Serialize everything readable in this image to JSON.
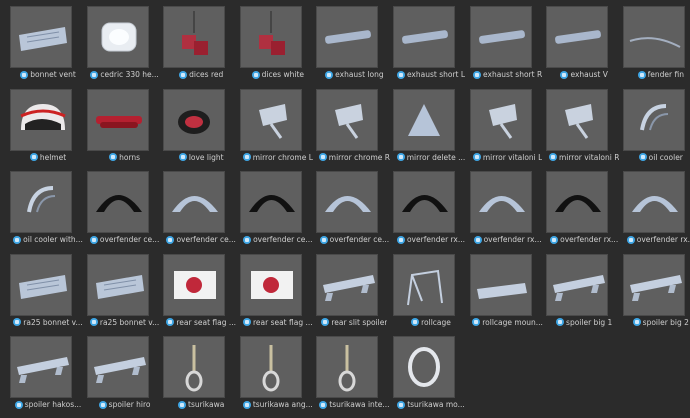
{
  "assets": [
    {
      "label": "bonnet vent",
      "icon": "bonnet-vent-thumbnail"
    },
    {
      "label": "cedric 330 he...",
      "icon": "headlight-thumbnail"
    },
    {
      "label": "dices red",
      "icon": "dice-thumbnail"
    },
    {
      "label": "dices white",
      "icon": "dice-thumbnail"
    },
    {
      "label": "exhaust long",
      "icon": "exhaust-thumbnail"
    },
    {
      "label": "exhaust short L",
      "icon": "exhaust-thumbnail"
    },
    {
      "label": "exhaust short R",
      "icon": "exhaust-thumbnail"
    },
    {
      "label": "exhaust V",
      "icon": "exhaust-thumbnail"
    },
    {
      "label": "fender fin",
      "icon": "fin-thumbnail"
    },
    {
      "label": "helmet",
      "icon": "helmet-thumbnail"
    },
    {
      "label": "horns",
      "icon": "horns-thumbnail"
    },
    {
      "label": "love light",
      "icon": "light-thumbnail"
    },
    {
      "label": "mirror chrome L",
      "icon": "mirror-thumbnail"
    },
    {
      "label": "mirror chrome R",
      "icon": "mirror-thumbnail"
    },
    {
      "label": "mirror delete ...",
      "icon": "mirror-delete-thumbnail"
    },
    {
      "label": "mirror vitaloni L",
      "icon": "mirror-thumbnail"
    },
    {
      "label": "mirror vitaloni R",
      "icon": "mirror-thumbnail"
    },
    {
      "label": "oil cooler",
      "icon": "oil-cooler-thumbnail"
    },
    {
      "label": "oil cooler with...",
      "icon": "oil-cooler-thumbnail"
    },
    {
      "label": "overfender ce...",
      "icon": "overfender-black-thumbnail"
    },
    {
      "label": "overfender ce...",
      "icon": "overfender-thumbnail"
    },
    {
      "label": "overfender ce...",
      "icon": "overfender-black-thumbnail"
    },
    {
      "label": "overfender ce...",
      "icon": "overfender-thumbnail"
    },
    {
      "label": "overfender rx...",
      "icon": "overfender-black-thumbnail"
    },
    {
      "label": "overfender rx...",
      "icon": "overfender-thumbnail"
    },
    {
      "label": "overfender rx...",
      "icon": "overfender-black-thumbnail"
    },
    {
      "label": "overfender rx...",
      "icon": "overfender-thumbnail"
    },
    {
      "label": "ra25 bonnet v...",
      "icon": "bonnet-vent-thumbnail"
    },
    {
      "label": "ra25 bonnet v...",
      "icon": "bonnet-vent-thumbnail"
    },
    {
      "label": "rear seat flag ...",
      "icon": "flag-thumbnail"
    },
    {
      "label": "rear seat flag ...",
      "icon": "flag-thumbnail"
    },
    {
      "label": "rear slit spoiler",
      "icon": "spoiler-thumbnail"
    },
    {
      "label": "rollcage",
      "icon": "rollcage-thumbnail"
    },
    {
      "label": "rollcage moun...",
      "icon": "rollcage-mount-thumbnail"
    },
    {
      "label": "spoiler big 1",
      "icon": "spoiler-thumbnail"
    },
    {
      "label": "spoiler big 2",
      "icon": "spoiler-thumbnail"
    },
    {
      "label": "spoiler hakos...",
      "icon": "spoiler-thumbnail"
    },
    {
      "label": "spoiler hiro",
      "icon": "spoiler-thumbnail"
    },
    {
      "label": "tsurikawa",
      "icon": "strap-thumbnail"
    },
    {
      "label": "tsurikawa ang...",
      "icon": "strap-thumbnail"
    },
    {
      "label": "tsurikawa inte...",
      "icon": "strap-thumbnail"
    },
    {
      "label": "tsurikawa mo...",
      "icon": "ring-thumbnail"
    }
  ],
  "colors": {
    "background": "#2b2b2b",
    "thumbnail_bg": "#5f5f5f",
    "caption_text": "#cfcfcf",
    "file_icon": "#3ea6e5"
  }
}
